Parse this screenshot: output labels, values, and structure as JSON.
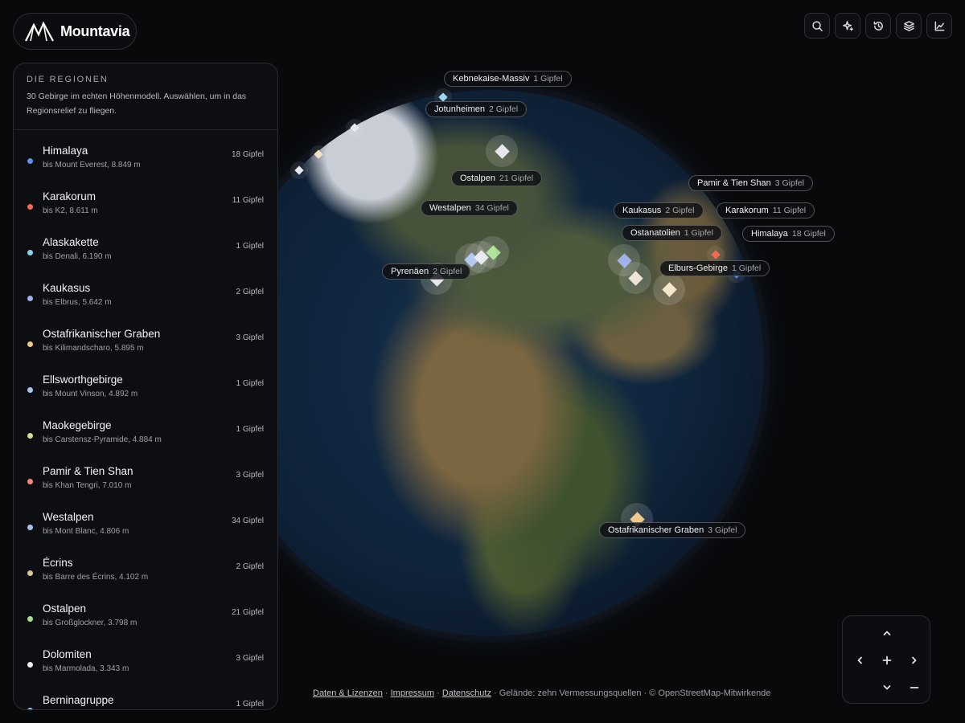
{
  "brand": {
    "name": "Mountavia",
    "logo_icon": "mountain-logo-icon"
  },
  "toolbar": [
    {
      "id": "search",
      "icon": "search-icon"
    },
    {
      "id": "sparkle",
      "icon": "sparkle-icon"
    },
    {
      "id": "history",
      "icon": "history-icon"
    },
    {
      "id": "layers",
      "icon": "layers-icon"
    },
    {
      "id": "stats",
      "icon": "chart-line-icon"
    }
  ],
  "panel": {
    "title": "Die Regionen",
    "subtitle": "30 Gebirge im echten Höhenmodell. Auswählen, um in das Regionsrelief zu fliegen.",
    "regions": [
      {
        "name": "Himalaya",
        "peak": "bis Mount Everest, 8.849 m",
        "count": "18 Gipfel",
        "color": "#5b8ff0"
      },
      {
        "name": "Karakorum",
        "peak": "bis K2, 8.611 m",
        "count": "11 Gipfel",
        "color": "#ef6b55"
      },
      {
        "name": "Alaskakette",
        "peak": "bis Denali, 6.190 m",
        "count": "1 Gipfel",
        "color": "#8ed1e8"
      },
      {
        "name": "Kaukasus",
        "peak": "bis Elbrus, 5.642 m",
        "count": "2 Gipfel",
        "color": "#9fb1ea"
      },
      {
        "name": "Ostafrikanischer Graben",
        "peak": "bis Kilimandscharo, 5.895 m",
        "count": "3 Gipfel",
        "color": "#f0c98a"
      },
      {
        "name": "Ellsworthgebirge",
        "peak": "bis Mount Vinson, 4.892 m",
        "count": "1 Gipfel",
        "color": "#a9c6ea"
      },
      {
        "name": "Maokegebirge",
        "peak": "bis Carstensz-Pyramide, 4.884 m",
        "count": "1 Gipfel",
        "color": "#cfe08a"
      },
      {
        "name": "Pamir & Tien Shan",
        "peak": "bis Khan Tengri, 7.010 m",
        "count": "3 Gipfel",
        "color": "#ee8a7a"
      },
      {
        "name": "Westalpen",
        "peak": "bis Mont Blanc, 4.806 m",
        "count": "34 Gipfel",
        "color": "#a8c0ee"
      },
      {
        "name": "Écrins",
        "peak": "bis Barre des Écrins, 4.102 m",
        "count": "2 Gipfel",
        "color": "#d8c4a0"
      },
      {
        "name": "Ostalpen",
        "peak": "bis Großglockner, 3.798 m",
        "count": "21 Gipfel",
        "color": "#a6e08e"
      },
      {
        "name": "Dolomiten",
        "peak": "bis Marmolada, 3.343 m",
        "count": "3 Gipfel",
        "color": "#eef0f4"
      },
      {
        "name": "Berninagruppe",
        "peak": "",
        "count": "1 Gipfel",
        "color": "#a9c4ee"
      }
    ]
  },
  "map_labels": [
    {
      "name": "Kebnekaise-Massiv",
      "count": "1 Gipfel"
    },
    {
      "name": "Jotunheimen",
      "count": "2 Gipfel"
    },
    {
      "name": "Ostalpen",
      "count": "21 Gipfel"
    },
    {
      "name": "Westalpen",
      "count": "34 Gipfel"
    },
    {
      "name": "Pyrenäen",
      "count": "2 Gipfel"
    },
    {
      "name": "Pamir & Tien Shan",
      "count": "3 Gipfel"
    },
    {
      "name": "Kaukasus",
      "count": "2 Gipfel"
    },
    {
      "name": "Karakorum",
      "count": "11 Gipfel"
    },
    {
      "name": "Ostanatolien",
      "count": "1 Gipfel"
    },
    {
      "name": "Himalaya",
      "count": "18 Gipfel"
    },
    {
      "name": "Elburs-Gebirge",
      "count": "1 Gipfel"
    },
    {
      "name": "Ostafrikanischer Graben",
      "count": "3 Gipfel"
    }
  ],
  "markers": [
    {
      "color": "#9fd8ee",
      "kind": "small"
    },
    {
      "color": "#e7e9ee",
      "kind": "small"
    },
    {
      "color": "#e7e9ee",
      "kind": "small"
    },
    {
      "color": "#f1e2c4",
      "kind": "small"
    },
    {
      "color": "#e6e8ee",
      "kind": "large"
    },
    {
      "color": "#e6e8ee",
      "kind": "large"
    },
    {
      "color": "#a8c0ee",
      "kind": "large"
    },
    {
      "color": "#a6e08e",
      "kind": "large"
    },
    {
      "color": "#e8eaf0",
      "kind": "large"
    },
    {
      "color": "#9fb1ea",
      "kind": "large"
    },
    {
      "color": "#eee5d6",
      "kind": "large"
    },
    {
      "color": "#f2e6cf",
      "kind": "large"
    },
    {
      "color": "#ef6b55",
      "kind": "small"
    },
    {
      "color": "#5b8ff0",
      "kind": "small"
    },
    {
      "color": "#f0c98a",
      "kind": "large"
    }
  ],
  "footer": {
    "links": [
      "Daten & Lizenzen",
      "Impressum",
      "Datenschutz"
    ],
    "text": "· Gelände: zehn Vermessungsquellen · © OpenStreetMap-Mitwirkende"
  },
  "navpad": {
    "buttons": [
      {
        "id": "up",
        "icon": "chevron-up-icon"
      },
      {
        "id": "left",
        "icon": "chevron-left-icon"
      },
      {
        "id": "zoom-in",
        "icon": "plus-icon"
      },
      {
        "id": "right",
        "icon": "chevron-right-icon"
      },
      {
        "id": "down",
        "icon": "chevron-down-icon"
      },
      {
        "id": "zoom-out",
        "icon": "minus-icon"
      }
    ]
  }
}
